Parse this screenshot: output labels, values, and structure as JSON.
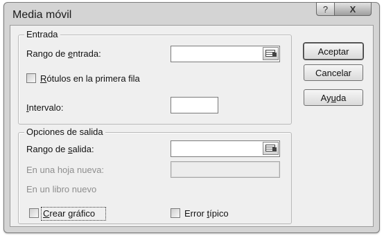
{
  "window": {
    "title": "Media móvil",
    "help_glyph": "?",
    "close_glyph": "X"
  },
  "entrada": {
    "legend": "Entrada",
    "rango_label_pre": "Rango de ",
    "rango_label_key": "e",
    "rango_label_post": "ntrada:",
    "rango_value": "",
    "rotulos_key": "R",
    "rotulos_rest": "ótulos en la primera fila",
    "rotulos_checked": false,
    "intervalo_key": "I",
    "intervalo_rest": "ntervalo:",
    "intervalo_value": ""
  },
  "salida": {
    "legend": "Opciones de salida",
    "rango_label_pre": "Rango de ",
    "rango_label_key": "s",
    "rango_label_post": "alida:",
    "rango_value": "",
    "hoja_label": "En una hoja nueva:",
    "hoja_value": "",
    "libro_label": "En un libro nuevo",
    "crear_key": "C",
    "crear_rest": "rear gráfico",
    "crear_checked": false,
    "error_pre": "Error ",
    "error_key": "t",
    "error_rest": "ípico",
    "error_checked": false
  },
  "buttons": {
    "aceptar": "Aceptar",
    "cancelar": "Cancelar",
    "ayuda_pre": "Ay",
    "ayuda_key": "u",
    "ayuda_post": "da"
  },
  "icons": {
    "range_picker": "collapse-dialog-icon"
  }
}
